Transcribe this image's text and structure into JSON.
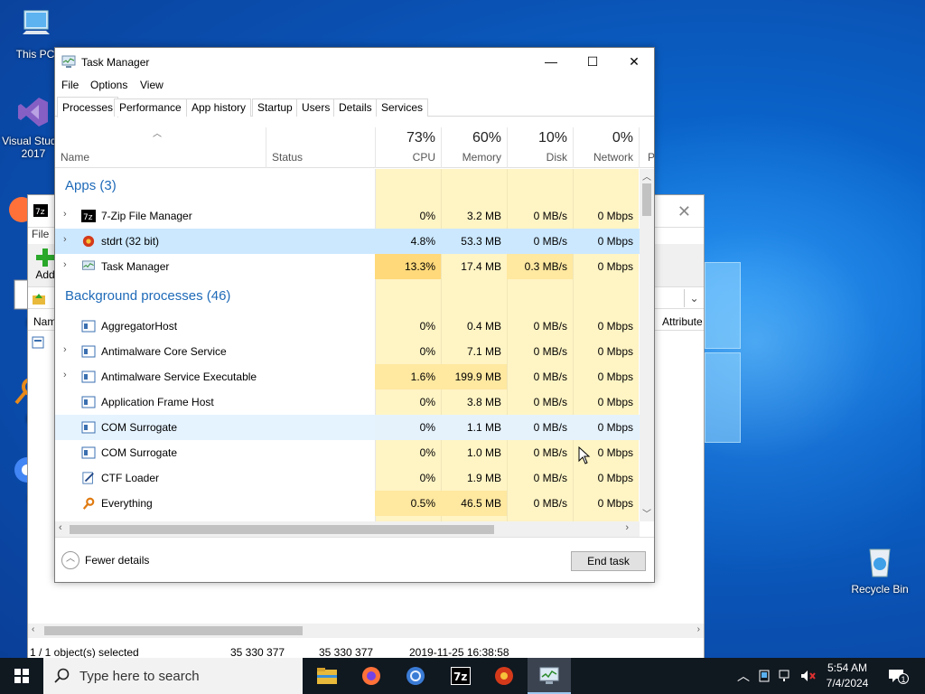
{
  "desktop": {
    "icons": [
      {
        "label": "This PC"
      },
      {
        "label": "Visual Studio 2017"
      },
      {
        "label": "Recycle Bin"
      }
    ],
    "partial_labels": [
      "F",
      "Not",
      "Eve",
      "Chr"
    ]
  },
  "zip_window": {
    "menu_item": "File",
    "toolbar_add": "Add",
    "column_name": "Nam",
    "column_attributes": "Attribute",
    "status": {
      "selected": "1 / 1 object(s) selected",
      "size": "35 330 377",
      "packed": "35 330 377",
      "modified": "2019-11-25 16:38:58"
    }
  },
  "task_manager": {
    "title": "Task Manager",
    "menu": [
      "File",
      "Options",
      "View"
    ],
    "tabs": [
      "Processes",
      "Performance",
      "App history",
      "Startup",
      "Users",
      "Details",
      "Services"
    ],
    "active_tab": "Processes",
    "columns": {
      "name": "Name",
      "status": "Status",
      "cpu": {
        "pct": "73%",
        "label": "CPU"
      },
      "memory": {
        "pct": "60%",
        "label": "Memory"
      },
      "disk": {
        "pct": "10%",
        "label": "Disk"
      },
      "network": {
        "pct": "0%",
        "label": "Network"
      },
      "power_partial": "P"
    },
    "groups": {
      "apps": "Apps (3)",
      "background": "Background processes (46)"
    },
    "apps": [
      {
        "name": "7-Zip File Manager",
        "cpu": "0%",
        "memory": "3.2 MB",
        "disk": "0 MB/s",
        "network": "0 Mbps"
      },
      {
        "name": "stdrt (32 bit)",
        "cpu": "4.8%",
        "memory": "53.3 MB",
        "disk": "0 MB/s",
        "network": "0 Mbps"
      },
      {
        "name": "Task Manager",
        "cpu": "13.3%",
        "memory": "17.4 MB",
        "disk": "0.3 MB/s",
        "network": "0 Mbps"
      }
    ],
    "background": [
      {
        "name": "AggregatorHost",
        "cpu": "0%",
        "memory": "0.4 MB",
        "disk": "0 MB/s",
        "network": "0 Mbps"
      },
      {
        "name": "Antimalware Core Service",
        "cpu": "0%",
        "memory": "7.1 MB",
        "disk": "0 MB/s",
        "network": "0 Mbps"
      },
      {
        "name": "Antimalware Service Executable",
        "cpu": "1.6%",
        "memory": "199.9 MB",
        "disk": "0 MB/s",
        "network": "0 Mbps"
      },
      {
        "name": "Application Frame Host",
        "cpu": "0%",
        "memory": "3.8 MB",
        "disk": "0 MB/s",
        "network": "0 Mbps"
      },
      {
        "name": "COM Surrogate",
        "cpu": "0%",
        "memory": "1.1 MB",
        "disk": "0 MB/s",
        "network": "0 Mbps"
      },
      {
        "name": "COM Surrogate",
        "cpu": "0%",
        "memory": "1.0 MB",
        "disk": "0 MB/s",
        "network": "0 Mbps"
      },
      {
        "name": "CTF Loader",
        "cpu": "0%",
        "memory": "1.9 MB",
        "disk": "0 MB/s",
        "network": "0 Mbps"
      },
      {
        "name": "Everything",
        "cpu": "0.5%",
        "memory": "46.5 MB",
        "disk": "0 MB/s",
        "network": "0 Mbps"
      }
    ],
    "fewer_details": "Fewer details",
    "end_task": "End task"
  },
  "taskbar": {
    "search_placeholder": "Type here to search",
    "time": "5:54 AM",
    "date": "7/4/2024",
    "notification_count": "1"
  },
  "colors": {
    "group_header": "#1e6ab8",
    "heat_light": "#fff4c4",
    "heat_mid": "#ffe8a0",
    "heat_strong": "#ffd97a",
    "selected_row": "#cce8ff",
    "hover_row": "#e5f3ff"
  }
}
